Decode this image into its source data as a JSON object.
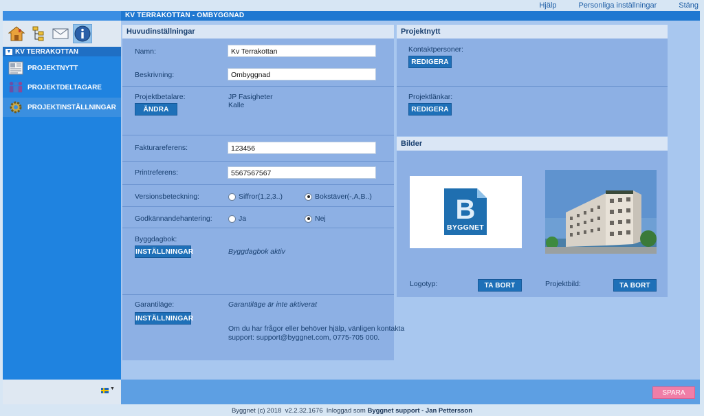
{
  "toplinks": {
    "help": "Hjälp",
    "personal_settings": "Personliga inställningar",
    "close": "Stäng"
  },
  "titlebar": {
    "title": "KV TERRAKOTTAN - OMBYGGNAD"
  },
  "sidebar": {
    "project_name": "KV TERRAKOTTAN",
    "items": [
      {
        "label": "PROJEKTNYTT",
        "icon": "newspaper-icon"
      },
      {
        "label": "PROJEKTDELTAGARE",
        "icon": "participants-icon"
      },
      {
        "label": "PROJEKTINSTÄLLNINGAR",
        "icon": "gear-icon"
      }
    ]
  },
  "main_settings": {
    "title": "Huvudinställningar",
    "name_label": "Namn:",
    "name_value": "Kv Terrakottan",
    "description_label": "Beskrivning:",
    "description_value": "Ombyggnad",
    "payer_label": "Projektbetalare:",
    "payer_company": "JP Fasigheter",
    "payer_person": "Kalle",
    "change_button": "ÄNDRA",
    "invoice_ref_label": "Fakturareferens:",
    "invoice_ref_value": "123456",
    "print_ref_label": "Printreferens:",
    "print_ref_value": "5567567567",
    "version_label": "Versionsbeteckning:",
    "version_opt1": "Siffror(1,2,3..)",
    "version_opt2": "Bokstäver(-,A,B..)",
    "approval_label": "Godkännandehantering:",
    "approval_yes": "Ja",
    "approval_no": "Nej",
    "diary_label": "Byggdagbok:",
    "diary_button": "INSTÄLLNINGAR",
    "diary_status": "Byggdagbok aktiv",
    "warranty_label": "Garantiläge:",
    "warranty_button": "INSTÄLLNINGAR",
    "warranty_status": "Garantiläge är inte aktiverat",
    "help_text_line1": "Om du har frågor eller behöver hjälp, vänligen kontakta",
    "help_text_line2": "support: support@byggnet.com, 0775-705 000."
  },
  "project_news": {
    "title": "Projektnytt",
    "contacts_label": "Kontaktpersoner:",
    "contacts_button": "REDIGERA",
    "links_label": "Projektlänkar:",
    "links_button": "REDIGERA"
  },
  "images": {
    "title": "Bilder",
    "logo_text": "BYGGNET",
    "logo_label": "Logotyp:",
    "logo_remove": "TA BORT",
    "project_image_label": "Projektbild:",
    "project_image_remove": "TA BORT"
  },
  "save_button": "SPARA",
  "footer": {
    "copyright": "Byggnet (c) 2018",
    "version": "v2.2.32.1676",
    "logged_in_prefix": "Inloggad som",
    "logged_in_user": "Byggnet support - Jan Pettersson"
  }
}
